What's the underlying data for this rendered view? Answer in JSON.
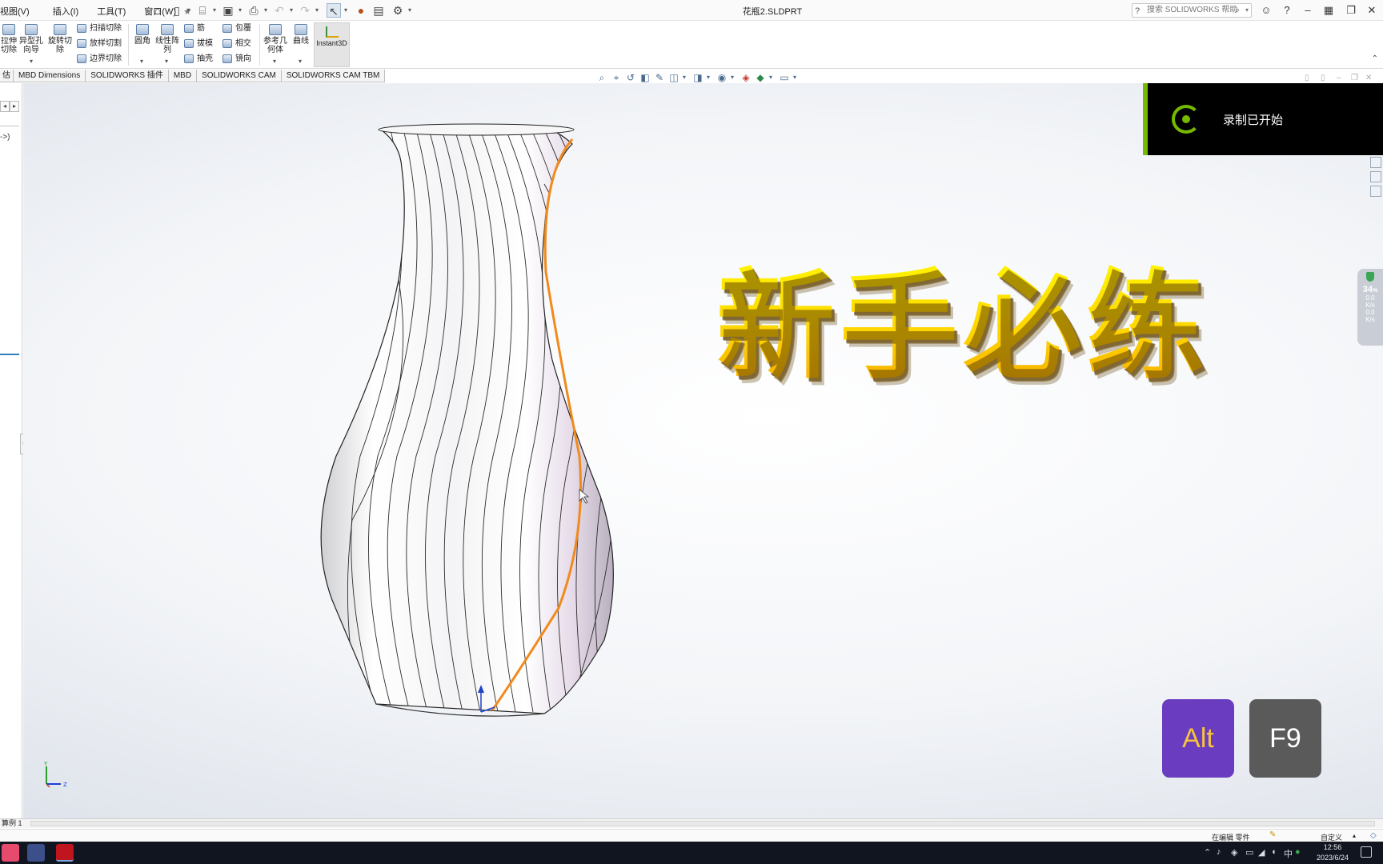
{
  "titlebar": {
    "menus": [
      "视图(V)",
      "插入(I)",
      "工具(T)",
      "窗口(W)"
    ],
    "document_title": "花瓶2.SLDPRT",
    "help_search_placeholder": "搜索 SOLIDWORKS 帮助"
  },
  "ribbon": {
    "big_buttons": [
      {
        "label": "拉伸切除",
        "icon": "extrude-cut-icon"
      },
      {
        "label": "异型孔向导",
        "icon": "hole-wizard-icon"
      },
      {
        "label": "旋转切除",
        "icon": "revolve-cut-icon"
      },
      {
        "label": "圆角",
        "icon": "fillet-icon"
      },
      {
        "label": "线性阵列",
        "icon": "linear-pattern-icon"
      },
      {
        "label": "参考几何体",
        "icon": "reference-geometry-icon"
      },
      {
        "label": "曲线",
        "icon": "curves-icon"
      }
    ],
    "small_buttons": [
      {
        "label": "扫描切除",
        "icon": "swept-cut-icon"
      },
      {
        "label": "放样切割",
        "icon": "lofted-cut-icon"
      },
      {
        "label": "边界切除",
        "icon": "boundary-cut-icon"
      },
      {
        "label": "筋",
        "icon": "rib-icon"
      },
      {
        "label": "拔模",
        "icon": "draft-icon"
      },
      {
        "label": "抽壳",
        "icon": "shell-icon"
      },
      {
        "label": "包覆",
        "icon": "wrap-icon"
      },
      {
        "label": "相交",
        "icon": "intersect-icon"
      },
      {
        "label": "镜向",
        "icon": "mirror-icon"
      }
    ],
    "instant3d_label": "Instant3D"
  },
  "tabs": [
    "估",
    "MBD Dimensions",
    "SOLIDWORKS 插件",
    "MBD",
    "SOLIDWORKS CAM",
    "SOLIDWORKS CAM TBM"
  ],
  "left_panel": {
    "text": "->)"
  },
  "overlay": {
    "headline": "新手必练",
    "recording_toast": "录制已开始",
    "keys": [
      "Alt",
      "F9"
    ],
    "perf_value": "34",
    "perf_unit": "%",
    "perf_lines": [
      "0.0",
      "K/s",
      "0.0",
      "K/s"
    ]
  },
  "triad_labels": {
    "y": "Y",
    "z": "Z"
  },
  "status": {
    "sheet_tab": "算例 1",
    "editing": "在编辑 零件",
    "units": "自定义"
  },
  "taskbar": {
    "ime": "中",
    "time": "12:56",
    "date": "2023/6/24"
  },
  "colors": {
    "headline_top": "#fff700",
    "headline_bottom": "#f3a600",
    "highlight_edge": "#f08a1c",
    "toast_accent": "#76b900",
    "alt_key_bg": "#6a3cc0",
    "alt_key_text": "#f6c43b",
    "f9_key_bg": "#5a5a5a"
  }
}
